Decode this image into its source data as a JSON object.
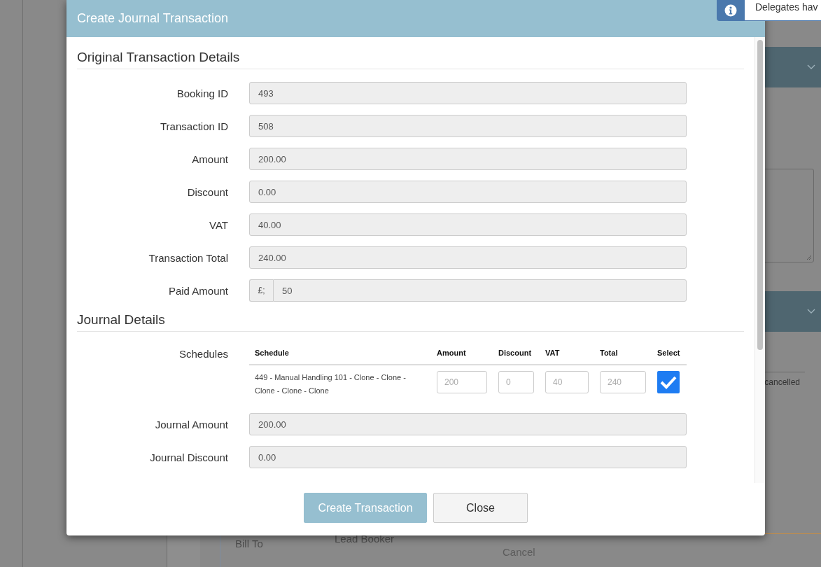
{
  "notification": {
    "text": "Delegates hav"
  },
  "background": {
    "status_text": "cancelled",
    "bill_to_label": "Bill To",
    "bill_to_value": "Lead Booker",
    "cancel_link": "Cancel"
  },
  "modal": {
    "title": "Create Journal Transaction",
    "original_section": {
      "heading": "Original Transaction Details",
      "fields": [
        {
          "label": "Booking ID",
          "value": "493"
        },
        {
          "label": "Transaction ID",
          "value": "508"
        },
        {
          "label": "Amount",
          "value": "200.00"
        },
        {
          "label": "Discount",
          "value": "0.00"
        },
        {
          "label": "VAT",
          "value": "40.00"
        },
        {
          "label": "Transaction Total",
          "value": "240.00"
        },
        {
          "label": "Paid Amount",
          "prefix": "£;",
          "value": "50"
        }
      ]
    },
    "journal_section": {
      "heading": "Journal Details",
      "schedules_label": "Schedules",
      "table": {
        "columns": [
          "Schedule",
          "Amount",
          "Discount",
          "VAT",
          "Total",
          "Select"
        ],
        "rows": [
          {
            "schedule": "449 - Manual Handling 101 - Clone - Clone - Clone - Clone - Clone",
            "amount": {
              "placeholder": "200"
            },
            "discount": {
              "placeholder": "0"
            },
            "vat": {
              "placeholder": "40"
            },
            "total": {
              "placeholder": "240"
            },
            "selected": true
          }
        ]
      },
      "fields": [
        {
          "label": "Journal Amount",
          "value": "200.00"
        },
        {
          "label": "Journal Discount",
          "value": "0.00"
        }
      ]
    },
    "buttons": [
      {
        "label": "Create Transaction",
        "kind": "primary"
      },
      {
        "label": "Close",
        "kind": "secondary"
      }
    ]
  }
}
